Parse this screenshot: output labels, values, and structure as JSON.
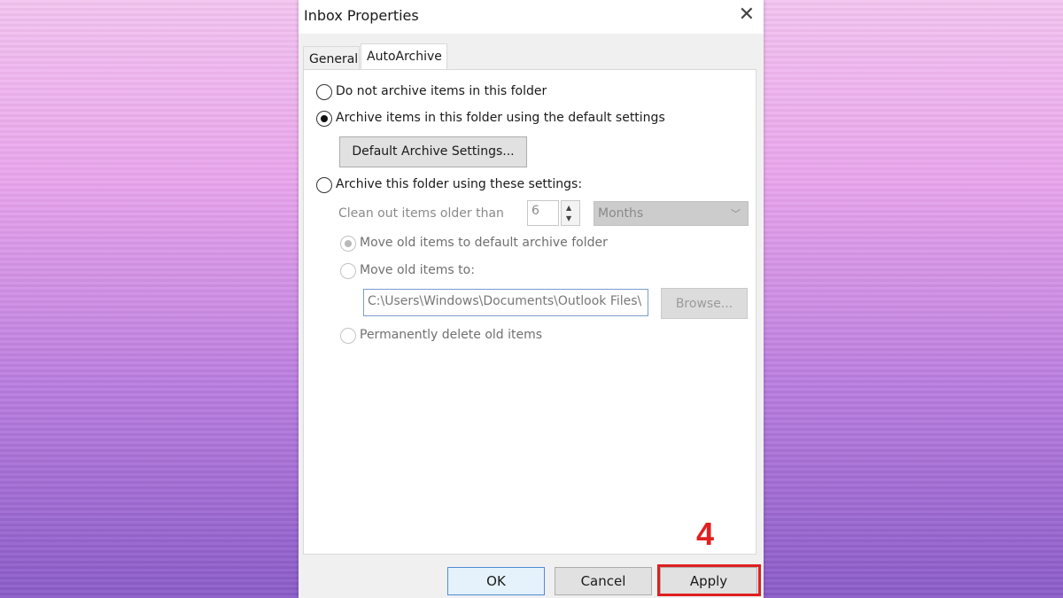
{
  "window": {
    "title": "Inbox Properties",
    "close_glyph": "✕"
  },
  "tabs": [
    {
      "label": "General"
    },
    {
      "label": "AutoArchive"
    }
  ],
  "options": {
    "no_archive": {
      "label": "Do not archive items in this folder",
      "selected": false
    },
    "default_archive": {
      "label": "Archive items in this folder using the default settings",
      "selected": true
    },
    "default_settings_button": "Default Archive Settings...",
    "custom_archive": {
      "label": "Archive this folder using these settings:",
      "selected": false
    }
  },
  "custom": {
    "clean_out_label": "Clean out items older than",
    "age_value": "6",
    "age_unit": "Months",
    "move_default": {
      "label": "Move old items to default archive folder",
      "selected": true
    },
    "move_to": {
      "label": "Move old items to:",
      "selected": false
    },
    "path": "C:\\Users\\Windows\\Documents\\Outlook Files\\",
    "browse_button": "Browse...",
    "delete": {
      "label": "Permanently delete old items",
      "selected": false
    }
  },
  "footer": {
    "ok": "OK",
    "cancel": "Cancel",
    "apply": "Apply"
  },
  "annotation": {
    "step_number": "4",
    "color": "#e02020"
  }
}
